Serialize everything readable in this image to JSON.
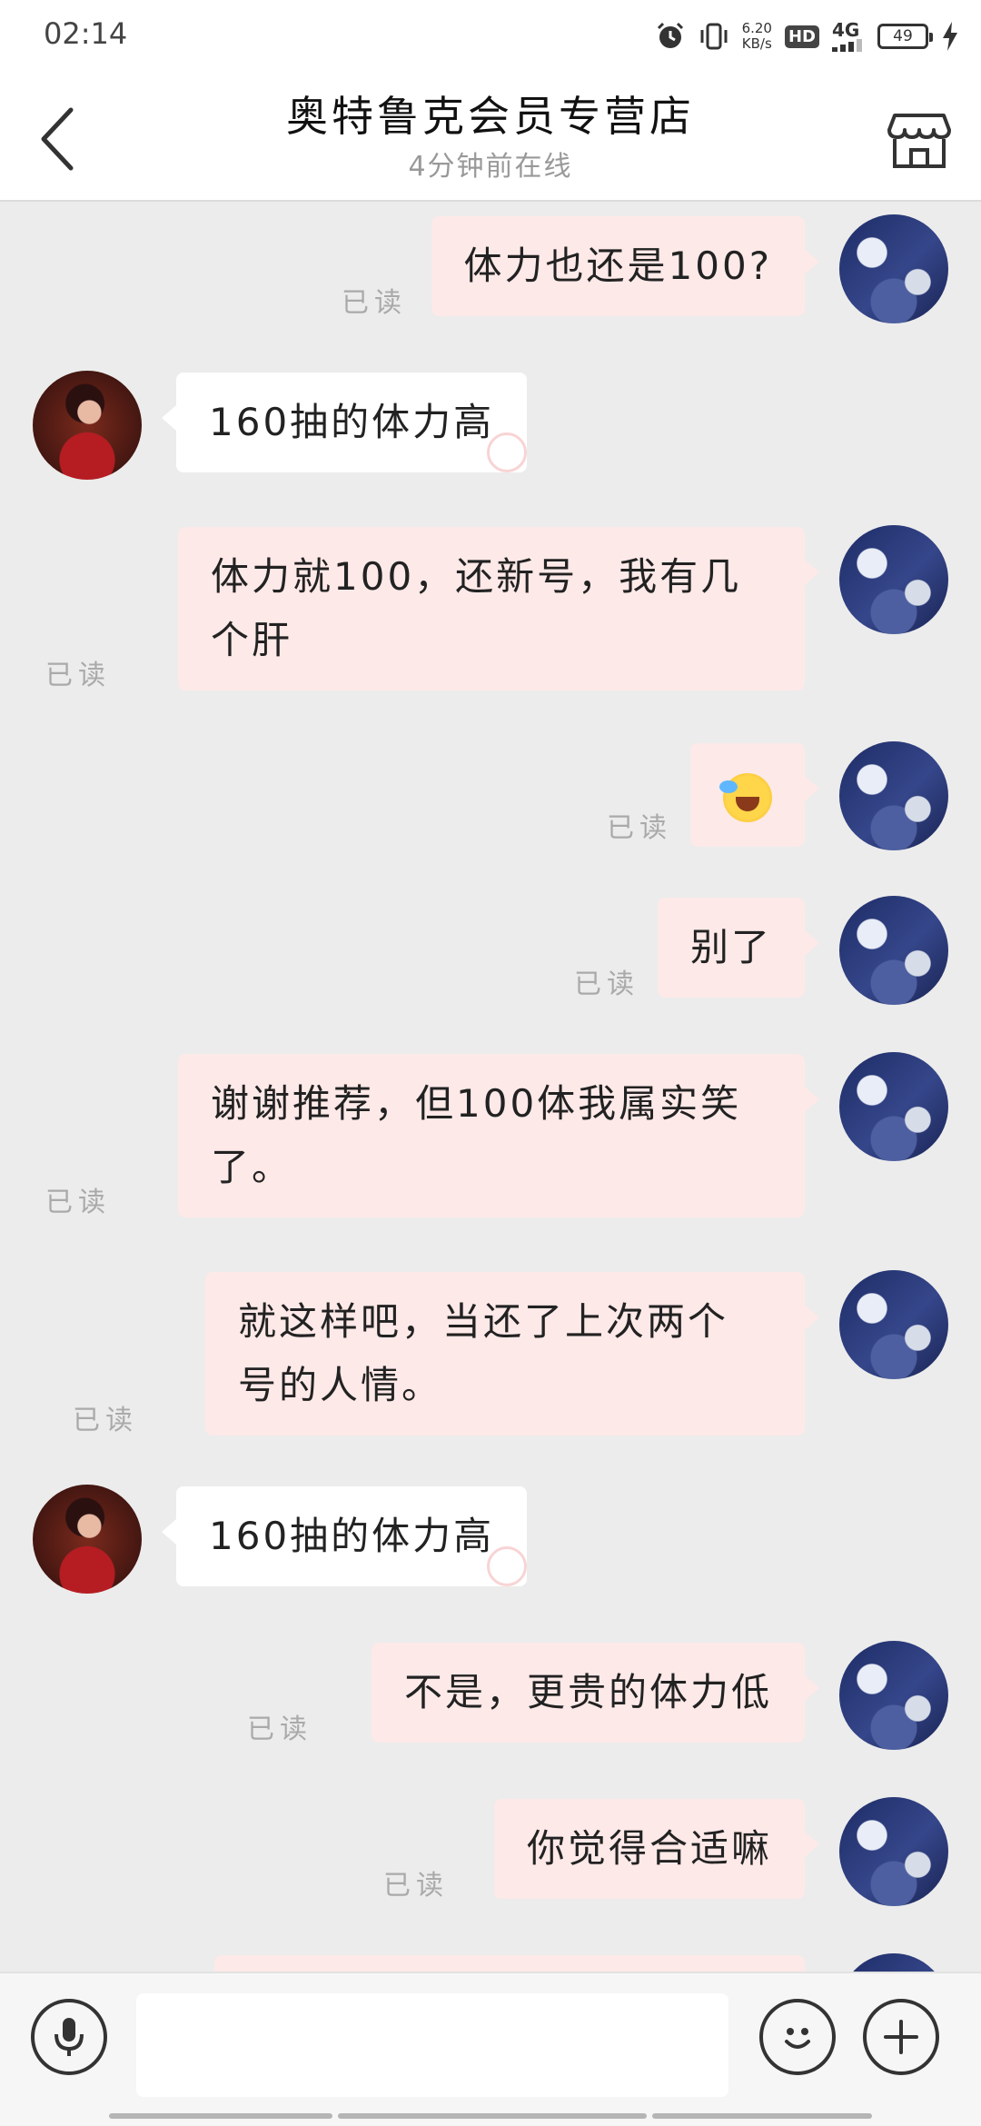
{
  "status_bar": {
    "time": "02:14",
    "speed_value": "6.20",
    "speed_unit": "KB/s",
    "hd_label": "HD",
    "network_label": "4G",
    "battery_level": "49",
    "icons": [
      "alarm-icon",
      "vibrate-icon",
      "signal-icon",
      "battery-icon",
      "charging-icon"
    ]
  },
  "header": {
    "title": "奥特鲁克会员专营店",
    "subtitle": "4分钟前在线",
    "icons": [
      "back-arrow-icon",
      "shop-icon"
    ]
  },
  "messages": [
    {
      "sender": "self",
      "text": "体力也还是100?",
      "read": "已读"
    },
    {
      "sender": "other",
      "text": "160抽的体力高"
    },
    {
      "sender": "self",
      "line1": "体力就100，还新号，我有几",
      "line2": "个肝",
      "read": "已读"
    },
    {
      "sender": "self",
      "emoji": "laughing-crying-emoji",
      "read": "已读"
    },
    {
      "sender": "self",
      "text": "别了",
      "read": "已读"
    },
    {
      "sender": "self",
      "line1": "谢谢推荐，但100体我属实笑",
      "line2": "了。",
      "read": "已读"
    },
    {
      "sender": "self",
      "line1": "就这样吧，当还了上次两个",
      "line2": "号的人情。",
      "read": "已读"
    },
    {
      "sender": "other",
      "text": "160抽的体力高"
    },
    {
      "sender": "self",
      "text": "不是，更贵的体力低",
      "read": "已读"
    },
    {
      "sender": "self",
      "text": "你觉得合适嘛",
      "read": "已读"
    }
  ],
  "input_bar": {
    "text_value": "",
    "icons": [
      "microphone-icon",
      "smiley-icon",
      "plus-icon"
    ]
  },
  "colors": {
    "self_bubble": "#fde9e8",
    "other_bubble": "#ffffff",
    "chat_background": "#ececec",
    "read_text": "#aaaaaa"
  }
}
